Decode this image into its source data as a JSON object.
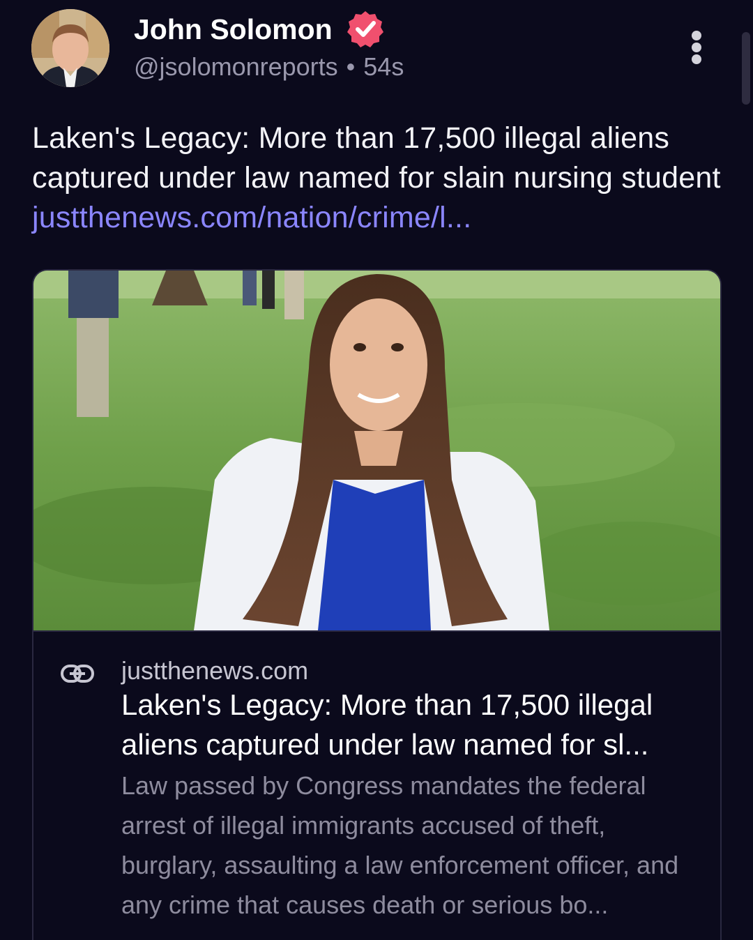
{
  "author": {
    "display_name": "John Solomon",
    "handle": "@jsolomonreports",
    "separator": "•",
    "timestamp": "54s",
    "verified_icon": "verified-badge-icon",
    "avatar_icon": "avatar-photo"
  },
  "post": {
    "text": "Laken's Legacy: More than 17,500 illegal aliens captured under law named for slain nursing student ",
    "link_text": "justthenews.com/nation/crime/l..."
  },
  "card": {
    "image_icon": "article-photo",
    "link_icon": "link-icon",
    "domain": "justthenews.com",
    "title": "Laken's Legacy: More than 17,500 illegal aliens captured under law named for sl...",
    "description": "Law passed by Congress mandates the federal arrest of illegal immigrants accused of theft, burglary, assaulting a law enforcement officer, and any crime that causes death or serious bo..."
  },
  "menu_icon": "more-options-icon",
  "colors": {
    "background": "#0b0a1c",
    "link": "#8b86ff",
    "verified": "#f0506e",
    "muted": "#9a98ad"
  }
}
